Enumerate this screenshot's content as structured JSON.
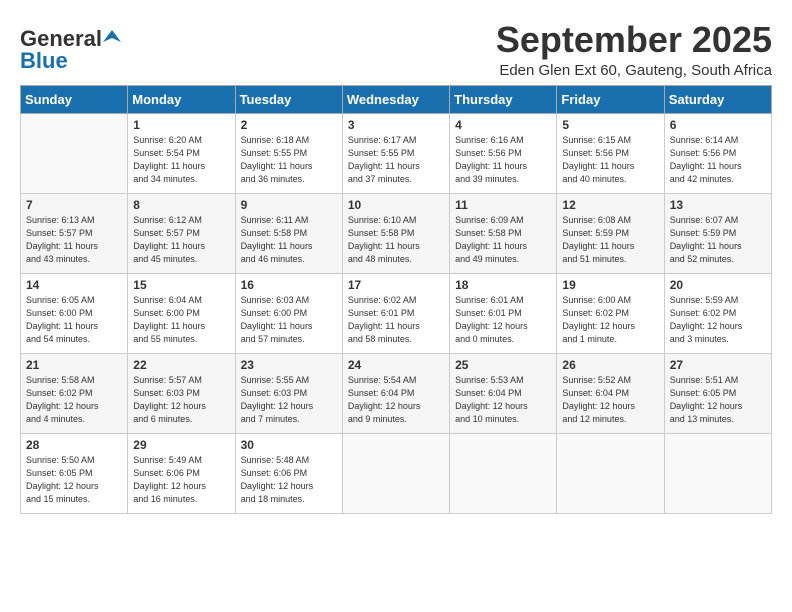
{
  "header": {
    "logo_general": "General",
    "logo_blue": "Blue",
    "month": "September 2025",
    "location": "Eden Glen Ext 60, Gauteng, South Africa"
  },
  "days_of_week": [
    "Sunday",
    "Monday",
    "Tuesday",
    "Wednesday",
    "Thursday",
    "Friday",
    "Saturday"
  ],
  "weeks": [
    [
      {
        "day": "",
        "info": ""
      },
      {
        "day": "1",
        "info": "Sunrise: 6:20 AM\nSunset: 5:54 PM\nDaylight: 11 hours\nand 34 minutes."
      },
      {
        "day": "2",
        "info": "Sunrise: 6:18 AM\nSunset: 5:55 PM\nDaylight: 11 hours\nand 36 minutes."
      },
      {
        "day": "3",
        "info": "Sunrise: 6:17 AM\nSunset: 5:55 PM\nDaylight: 11 hours\nand 37 minutes."
      },
      {
        "day": "4",
        "info": "Sunrise: 6:16 AM\nSunset: 5:56 PM\nDaylight: 11 hours\nand 39 minutes."
      },
      {
        "day": "5",
        "info": "Sunrise: 6:15 AM\nSunset: 5:56 PM\nDaylight: 11 hours\nand 40 minutes."
      },
      {
        "day": "6",
        "info": "Sunrise: 6:14 AM\nSunset: 5:56 PM\nDaylight: 11 hours\nand 42 minutes."
      }
    ],
    [
      {
        "day": "7",
        "info": "Sunrise: 6:13 AM\nSunset: 5:57 PM\nDaylight: 11 hours\nand 43 minutes."
      },
      {
        "day": "8",
        "info": "Sunrise: 6:12 AM\nSunset: 5:57 PM\nDaylight: 11 hours\nand 45 minutes."
      },
      {
        "day": "9",
        "info": "Sunrise: 6:11 AM\nSunset: 5:58 PM\nDaylight: 11 hours\nand 46 minutes."
      },
      {
        "day": "10",
        "info": "Sunrise: 6:10 AM\nSunset: 5:58 PM\nDaylight: 11 hours\nand 48 minutes."
      },
      {
        "day": "11",
        "info": "Sunrise: 6:09 AM\nSunset: 5:58 PM\nDaylight: 11 hours\nand 49 minutes."
      },
      {
        "day": "12",
        "info": "Sunrise: 6:08 AM\nSunset: 5:59 PM\nDaylight: 11 hours\nand 51 minutes."
      },
      {
        "day": "13",
        "info": "Sunrise: 6:07 AM\nSunset: 5:59 PM\nDaylight: 11 hours\nand 52 minutes."
      }
    ],
    [
      {
        "day": "14",
        "info": "Sunrise: 6:05 AM\nSunset: 6:00 PM\nDaylight: 11 hours\nand 54 minutes."
      },
      {
        "day": "15",
        "info": "Sunrise: 6:04 AM\nSunset: 6:00 PM\nDaylight: 11 hours\nand 55 minutes."
      },
      {
        "day": "16",
        "info": "Sunrise: 6:03 AM\nSunset: 6:00 PM\nDaylight: 11 hours\nand 57 minutes."
      },
      {
        "day": "17",
        "info": "Sunrise: 6:02 AM\nSunset: 6:01 PM\nDaylight: 11 hours\nand 58 minutes."
      },
      {
        "day": "18",
        "info": "Sunrise: 6:01 AM\nSunset: 6:01 PM\nDaylight: 12 hours\nand 0 minutes."
      },
      {
        "day": "19",
        "info": "Sunrise: 6:00 AM\nSunset: 6:02 PM\nDaylight: 12 hours\nand 1 minute."
      },
      {
        "day": "20",
        "info": "Sunrise: 5:59 AM\nSunset: 6:02 PM\nDaylight: 12 hours\nand 3 minutes."
      }
    ],
    [
      {
        "day": "21",
        "info": "Sunrise: 5:58 AM\nSunset: 6:02 PM\nDaylight: 12 hours\nand 4 minutes."
      },
      {
        "day": "22",
        "info": "Sunrise: 5:57 AM\nSunset: 6:03 PM\nDaylight: 12 hours\nand 6 minutes."
      },
      {
        "day": "23",
        "info": "Sunrise: 5:55 AM\nSunset: 6:03 PM\nDaylight: 12 hours\nand 7 minutes."
      },
      {
        "day": "24",
        "info": "Sunrise: 5:54 AM\nSunset: 6:04 PM\nDaylight: 12 hours\nand 9 minutes."
      },
      {
        "day": "25",
        "info": "Sunrise: 5:53 AM\nSunset: 6:04 PM\nDaylight: 12 hours\nand 10 minutes."
      },
      {
        "day": "26",
        "info": "Sunrise: 5:52 AM\nSunset: 6:04 PM\nDaylight: 12 hours\nand 12 minutes."
      },
      {
        "day": "27",
        "info": "Sunrise: 5:51 AM\nSunset: 6:05 PM\nDaylight: 12 hours\nand 13 minutes."
      }
    ],
    [
      {
        "day": "28",
        "info": "Sunrise: 5:50 AM\nSunset: 6:05 PM\nDaylight: 12 hours\nand 15 minutes."
      },
      {
        "day": "29",
        "info": "Sunrise: 5:49 AM\nSunset: 6:06 PM\nDaylight: 12 hours\nand 16 minutes."
      },
      {
        "day": "30",
        "info": "Sunrise: 5:48 AM\nSunset: 6:06 PM\nDaylight: 12 hours\nand 18 minutes."
      },
      {
        "day": "",
        "info": ""
      },
      {
        "day": "",
        "info": ""
      },
      {
        "day": "",
        "info": ""
      },
      {
        "day": "",
        "info": ""
      }
    ]
  ]
}
